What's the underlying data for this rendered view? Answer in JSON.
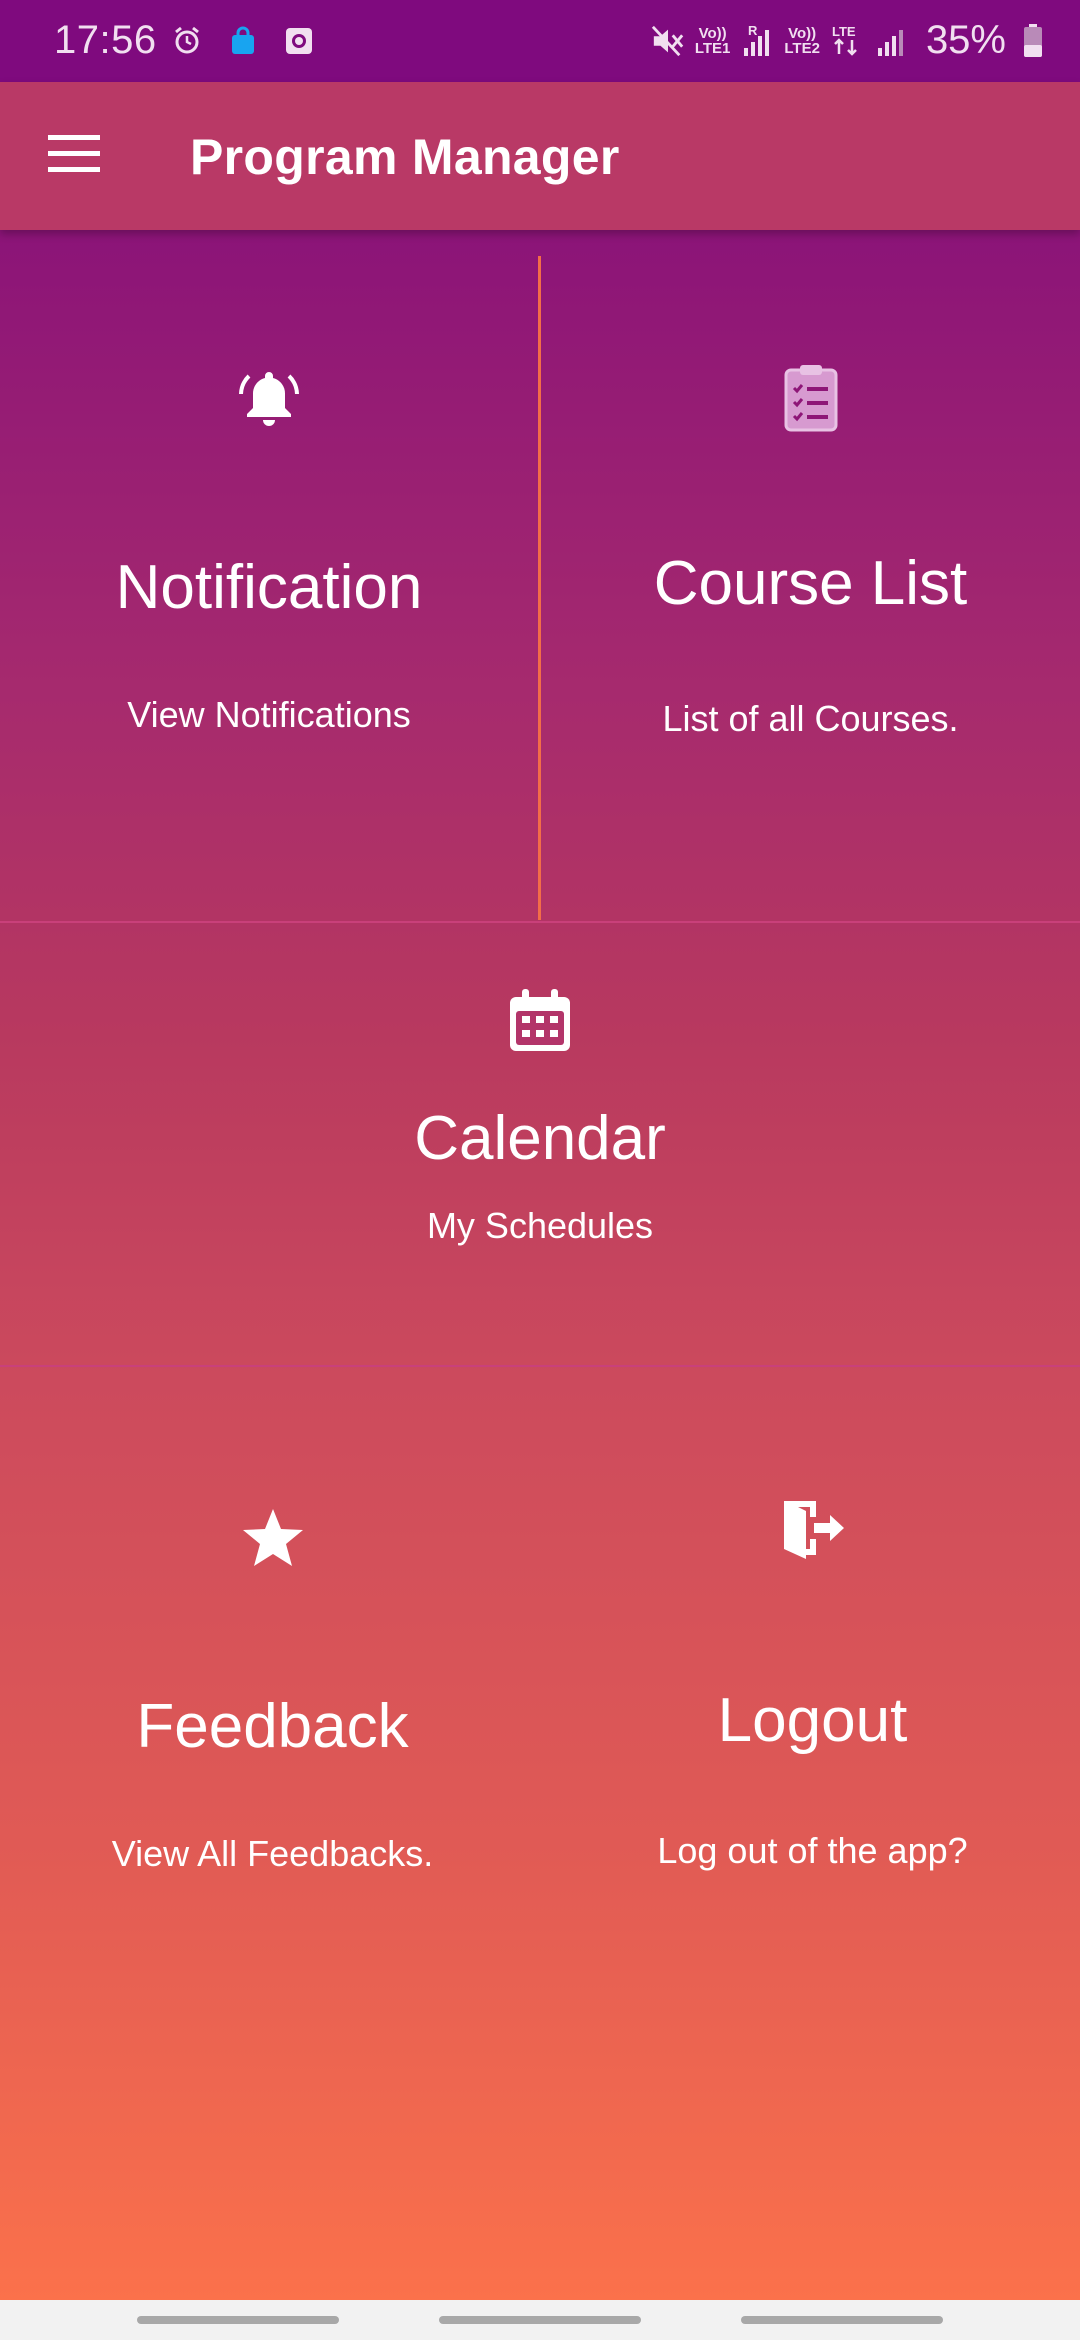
{
  "status_bar": {
    "time": "17:56",
    "sim1_label": "Vo))\nLTE1",
    "sim2_label": "Vo))\nLTE2",
    "roaming": "R",
    "data_type": "LTE",
    "battery": "35%"
  },
  "app_bar": {
    "title": "Program Manager",
    "menu_icon": "menu-icon"
  },
  "tiles": {
    "notification": {
      "title": "Notification",
      "subtitle": "View Notifications",
      "icon": "bell-icon"
    },
    "course_list": {
      "title": "Course List",
      "subtitle": "List of all Courses.",
      "icon": "clipboard-icon"
    },
    "calendar": {
      "title": "Calendar",
      "subtitle": "My Schedules",
      "icon": "calendar-icon"
    },
    "feedback": {
      "title": "Feedback",
      "subtitle": "View All Feedbacks.",
      "icon": "star-icon"
    },
    "logout": {
      "title": "Logout",
      "subtitle": "Log out of the app?",
      "icon": "logout-icon"
    }
  },
  "colors": {
    "status_bar": "#7f0a7e",
    "app_bar": "#b93966",
    "gradient_top": "#7d0a7c",
    "gradient_bottom": "#fb714b",
    "divider_vertical": "#f36d48"
  }
}
